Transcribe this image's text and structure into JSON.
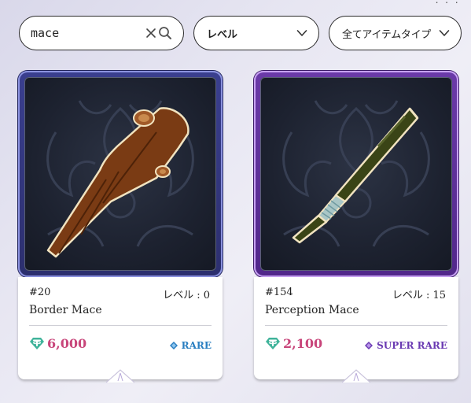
{
  "search": {
    "value": "mace"
  },
  "filters": {
    "level_label": "レベル",
    "type_label": "全てアイテムタイプ"
  },
  "cards": [
    {
      "id": "#20",
      "level": "レベル : 0",
      "name": "Border Mace",
      "price": "6,000",
      "rarity": "RARE",
      "rarity_color": "#2a7fc1",
      "frame_color": "#3a3f8f"
    },
    {
      "id": "#154",
      "level": "レベル : 15",
      "name": "Perception Mace",
      "price": "2,100",
      "rarity": "SUPER RARE",
      "rarity_color": "#6a3ab2",
      "frame_color": "#6b3aa8"
    }
  ],
  "icons": {
    "clear": "close-icon",
    "search": "search-icon",
    "dropdown": "chevron-down-icon",
    "currency": "tether-coin-icon",
    "rarity": "gem-icon"
  },
  "colors": {
    "price": "#c8457a",
    "coin": "#3fb39a"
  }
}
